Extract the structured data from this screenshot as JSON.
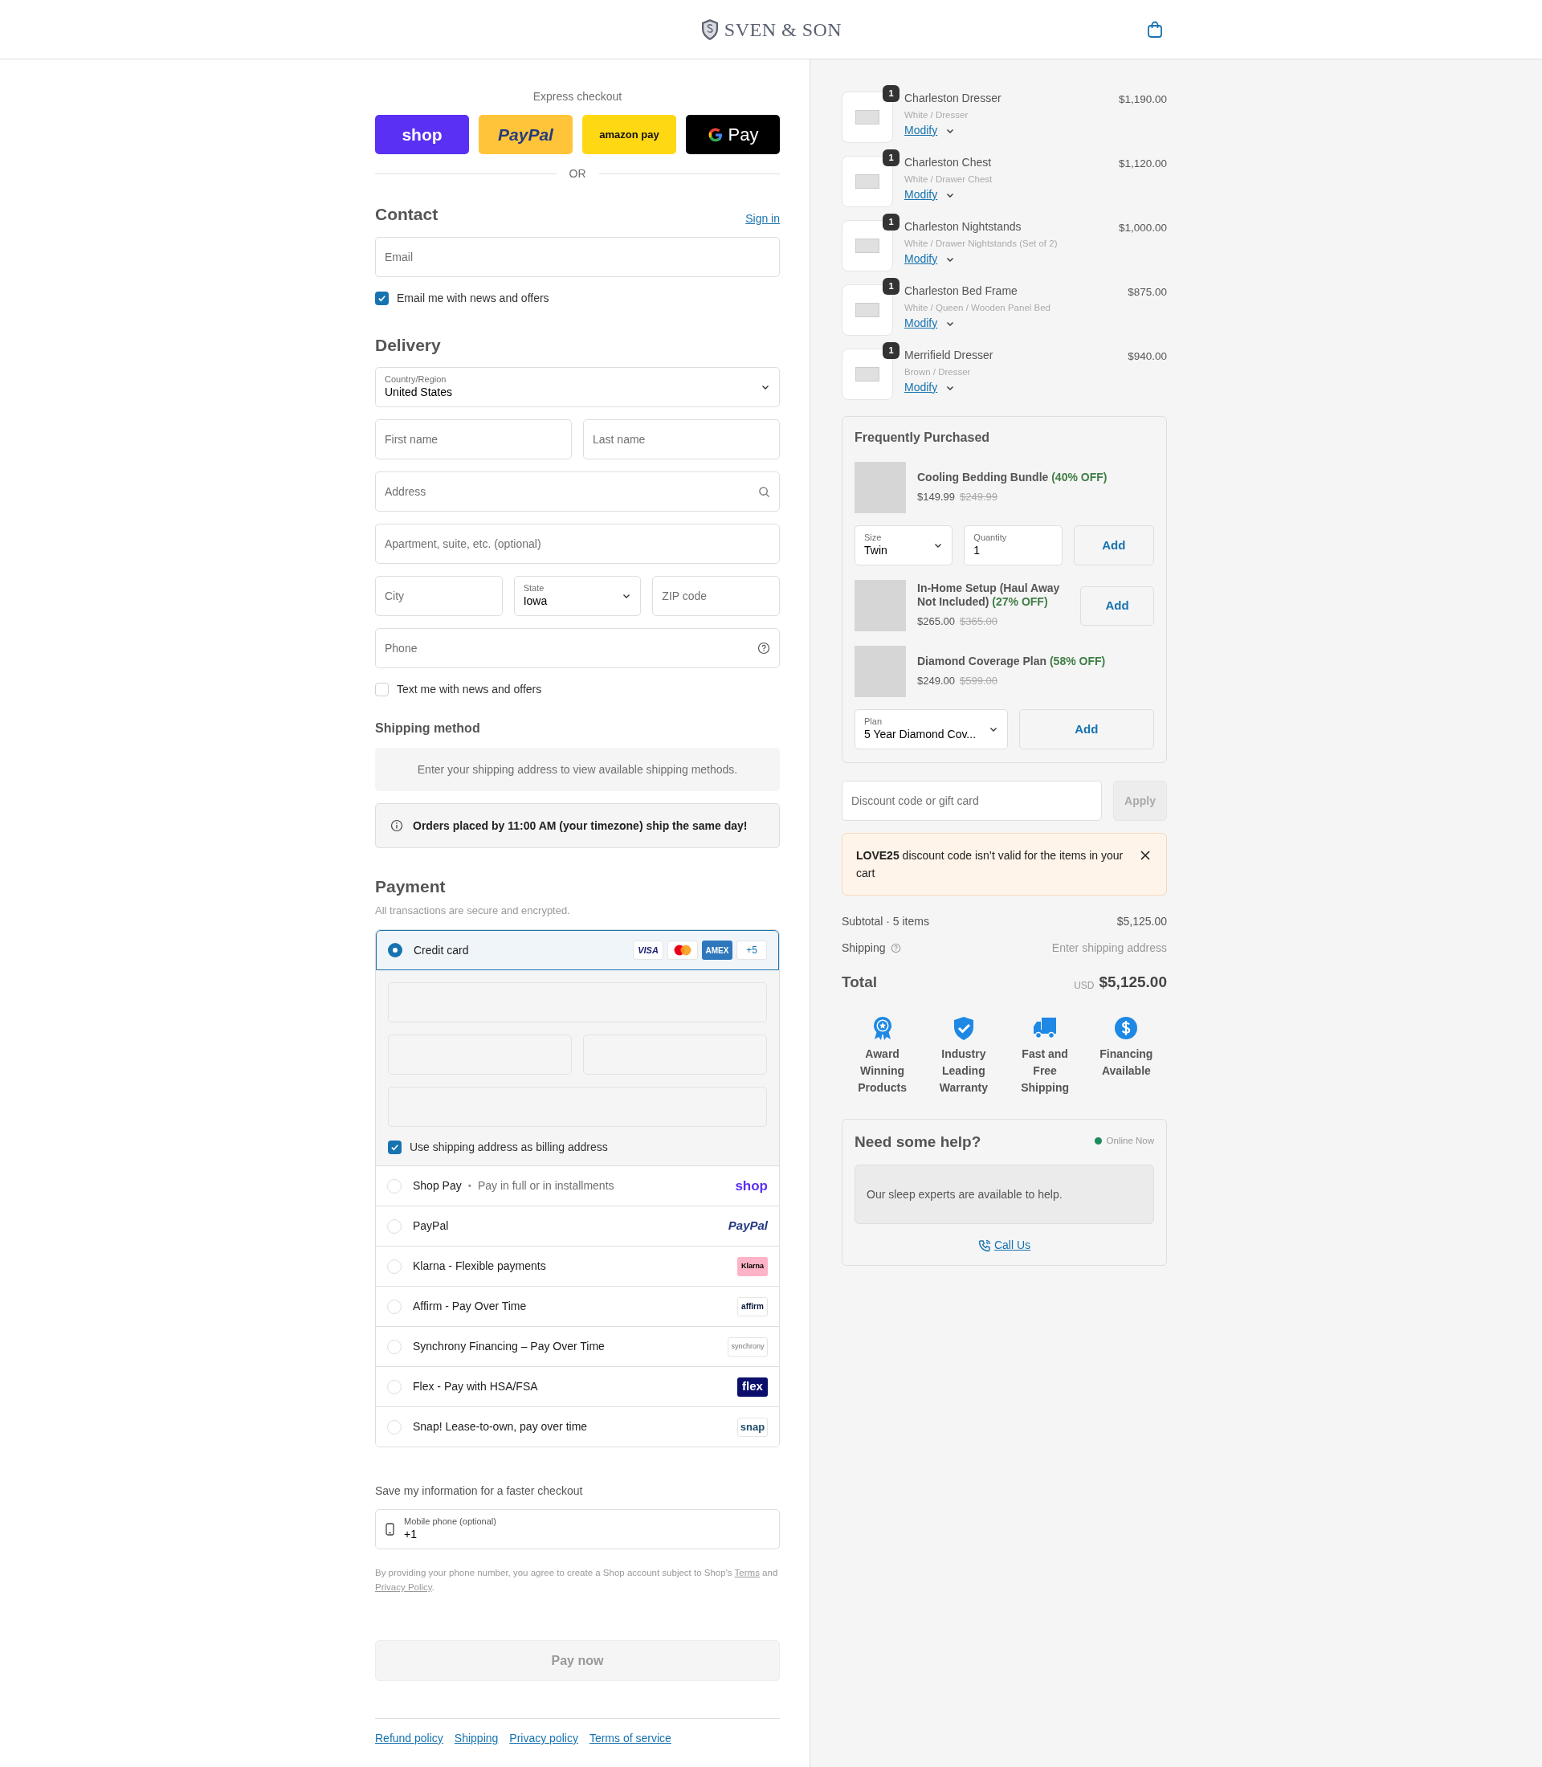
{
  "header": {
    "brand": "SVEN & SON"
  },
  "express": {
    "label": "Express checkout",
    "divider": "OR",
    "buttons": [
      {
        "kind": "shop",
        "label": "shop"
      },
      {
        "kind": "paypal",
        "label": "PayPal"
      },
      {
        "kind": "amazon",
        "label": "amazon pay"
      },
      {
        "kind": "gpay",
        "label": "Pay"
      }
    ]
  },
  "contact": {
    "title": "Contact",
    "sign_in": "Sign in",
    "email": {
      "placeholder": "Email"
    },
    "newsletter": {
      "label": "Email me with news and offers",
      "checked": true
    }
  },
  "delivery": {
    "title": "Delivery",
    "rows": [
      {
        "fields": [
          {
            "kind": "select",
            "label": "Country/Region",
            "value": "United States"
          }
        ]
      },
      {
        "fields": [
          {
            "kind": "text",
            "placeholder": "First name"
          },
          {
            "kind": "text",
            "placeholder": "Last name"
          }
        ]
      },
      {
        "fields": [
          {
            "kind": "search",
            "placeholder": "Address"
          }
        ]
      },
      {
        "fields": [
          {
            "kind": "text",
            "placeholder": "Apartment, suite, etc. (optional)"
          }
        ]
      },
      {
        "fields": [
          {
            "kind": "text",
            "placeholder": "City"
          },
          {
            "kind": "select",
            "label": "State",
            "value": "Iowa"
          },
          {
            "kind": "text",
            "placeholder": "ZIP code"
          }
        ]
      },
      {
        "fields": [
          {
            "kind": "help",
            "placeholder": "Phone"
          }
        ]
      }
    ],
    "sms": {
      "label": "Text me with news and offers",
      "checked": false
    }
  },
  "shipping_method": {
    "title": "Shipping method",
    "notice": "Enter your shipping address to view available shipping methods."
  },
  "banner": "Orders placed by 11:00 AM (your timezone) ship the same day!",
  "payment": {
    "title": "Payment",
    "subtitle": "All transactions are secure and encrypted.",
    "methods": [
      {
        "kind": "card",
        "label": "Credit card",
        "selected": true,
        "brands": [
          {
            "kind": "visa",
            "label": "VISA"
          },
          {
            "kind": "mastercard"
          },
          {
            "kind": "amex",
            "label": "AMEX"
          },
          {
            "kind": "more",
            "label": "+5"
          }
        ],
        "billing": {
          "label": "Use shipping address as billing address",
          "checked": true
        }
      },
      {
        "kind": "shop",
        "label": "Shop Pay",
        "separator": "•",
        "note": "Pay in full or in installments",
        "logo": "shop",
        "selected": false
      },
      {
        "kind": "paypal",
        "label": "PayPal",
        "logo": "PayPal",
        "selected": false
      },
      {
        "kind": "klarna",
        "label": "Klarna - Flexible payments",
        "logo": "Klarna",
        "selected": false
      },
      {
        "kind": "affirm",
        "label": "Affirm - Pay Over Time",
        "logo": "affirm",
        "selected": false
      },
      {
        "kind": "synchrony",
        "label": "Synchrony Financing – Pay Over Time",
        "logo": "synchrony",
        "selected": false
      },
      {
        "kind": "flex",
        "label": "Flex - Pay with HSA/FSA",
        "logo": "flex",
        "selected": false
      },
      {
        "kind": "snap",
        "label": "Snap! Lease-to-own, pay over time",
        "logo": "snap",
        "selected": false
      }
    ]
  },
  "save_info": {
    "title": "Save my information for a faster checkout",
    "phone": {
      "label": "Mobile phone (optional)",
      "value": "+1"
    },
    "legal": {
      "before": "By providing your phone number, you agree to create a Shop account subject to Shop's ",
      "terms": "Terms",
      "middle": " and ",
      "privacy": "Privacy Policy",
      "after": "."
    }
  },
  "pay_button": "Pay now",
  "footer_links": [
    "Refund policy",
    "Shipping",
    "Privacy policy",
    "Terms of service"
  ],
  "cart": [
    {
      "name": "Charleston Dresser",
      "variant": "White / Dresser",
      "price": "$1,190.00",
      "quantity": "1",
      "modify": "Modify"
    },
    {
      "name": "Charleston Chest",
      "variant": "White / Drawer Chest",
      "price": "$1,120.00",
      "quantity": "1",
      "modify": "Modify"
    },
    {
      "name": "Charleston Nightstands",
      "variant": "White / Drawer Nightstands (Set of 2)",
      "price": "$1,000.00",
      "quantity": "1",
      "modify": "Modify"
    },
    {
      "name": "Charleston Bed Frame",
      "variant": "White / Queen / Wooden Panel Bed",
      "price": "$875.00",
      "quantity": "1",
      "modify": "Modify"
    },
    {
      "name": "Merrifield Dresser",
      "variant": "Brown / Dresser",
      "price": "$940.00",
      "quantity": "1",
      "modify": "Modify"
    }
  ],
  "frequently_purchased": {
    "title": "Frequently Purchased",
    "items": [
      {
        "kind": "stacked",
        "name": "Cooling Bedding Bundle",
        "discount": "(40% OFF)",
        "price": "$149.99",
        "old_price": "$249.99",
        "options": [
          {
            "kind": "select",
            "label": "Size",
            "value": "Twin"
          },
          {
            "kind": "number",
            "label": "Quantity",
            "value": "1"
          }
        ],
        "add": "Add"
      },
      {
        "kind": "inline",
        "name": "In-Home Setup (Haul Away Not Included)",
        "discount": "(27% OFF)",
        "price": "$265.00",
        "old_price": "$365.00",
        "add": "Add"
      },
      {
        "kind": "stacked",
        "name": "Diamond Coverage Plan",
        "discount": "(58% OFF)",
        "price": "$249.00",
        "old_price": "$599.00",
        "options": [
          {
            "kind": "select",
            "label": "Plan",
            "value": "5 Year Diamond Cov..."
          }
        ],
        "add": "Add"
      }
    ]
  },
  "discount": {
    "placeholder": "Discount code or gift card",
    "apply": "Apply"
  },
  "alert": {
    "message": "**LOVE25** discount code isn’t valid for the items in your cart"
  },
  "summary": {
    "subtotal_label": "Subtotal · 5 items",
    "subtotal": "$5,125.00",
    "shipping_label": "Shipping",
    "shipping": "Enter shipping address",
    "total_label": "Total",
    "currency": "USD",
    "total": "$5,125.00"
  },
  "badges": [
    {
      "kind": "award",
      "label": "Award Winning Products"
    },
    {
      "kind": "shield",
      "label": "Industry Leading Warranty"
    },
    {
      "kind": "truck",
      "label": "Fast and Free Shipping"
    },
    {
      "kind": "dollar",
      "label": "Financing Available"
    }
  ],
  "help": {
    "title": "Need some help?",
    "status": "Online Now",
    "online": true,
    "message": "Our sleep experts are available to help.",
    "call": "Call Us"
  }
}
